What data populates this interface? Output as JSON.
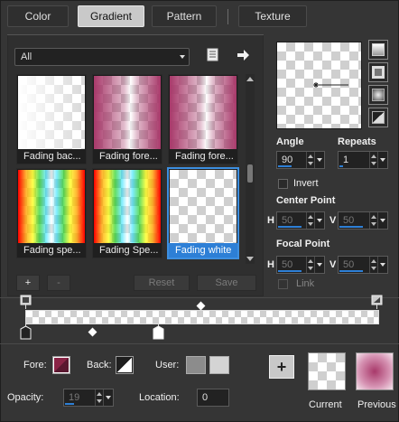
{
  "tabs": [
    {
      "label": "Color",
      "active": false
    },
    {
      "label": "Gradient",
      "active": true
    },
    {
      "label": "Pattern",
      "active": false
    },
    {
      "label": "Texture",
      "active": false
    }
  ],
  "category": {
    "selected": "All"
  },
  "gradients": [
    {
      "caption": "Fading bac...",
      "kind": "checker-fade-left",
      "selected": false
    },
    {
      "caption": "Fading fore...",
      "kind": "magenta-checker",
      "selected": false
    },
    {
      "caption": "Fading fore...",
      "kind": "magenta-checker",
      "selected": false
    },
    {
      "caption": "Fading spe...",
      "kind": "spectrum",
      "selected": false
    },
    {
      "caption": "Fading Spe...",
      "kind": "spectrum",
      "selected": false
    },
    {
      "caption": "Fading white",
      "kind": "checker-white",
      "selected": true
    }
  ],
  "buttons": {
    "add": "+",
    "remove": "-",
    "reset": "Reset",
    "save": "Save"
  },
  "angle": {
    "label": "Angle",
    "value": "90"
  },
  "repeats": {
    "label": "Repeats",
    "value": "1"
  },
  "invert": {
    "label": "Invert",
    "checked": false
  },
  "center_point": {
    "label": "Center Point",
    "h_label": "H",
    "h_value": "50",
    "v_label": "V",
    "v_value": "50"
  },
  "focal_point": {
    "label": "Focal Point",
    "h_label": "H",
    "h_value": "50",
    "v_label": "V",
    "v_value": "50"
  },
  "link": {
    "label": "Link",
    "checked": false
  },
  "fore": {
    "label": "Fore:",
    "color": "#8a2446"
  },
  "back": {
    "label": "Back:"
  },
  "user": {
    "label": "User:",
    "swatch1": "#8c8c8c",
    "swatch2": "#d4d4d4"
  },
  "opacity": {
    "label": "Opacity:",
    "value": "19"
  },
  "location": {
    "label": "Location:",
    "value": "0"
  },
  "add_button": "+",
  "current_label": "Current",
  "previous_label": "Previous",
  "colors": {
    "accent": "#2d7fd6",
    "magenta": "#a8396a"
  }
}
